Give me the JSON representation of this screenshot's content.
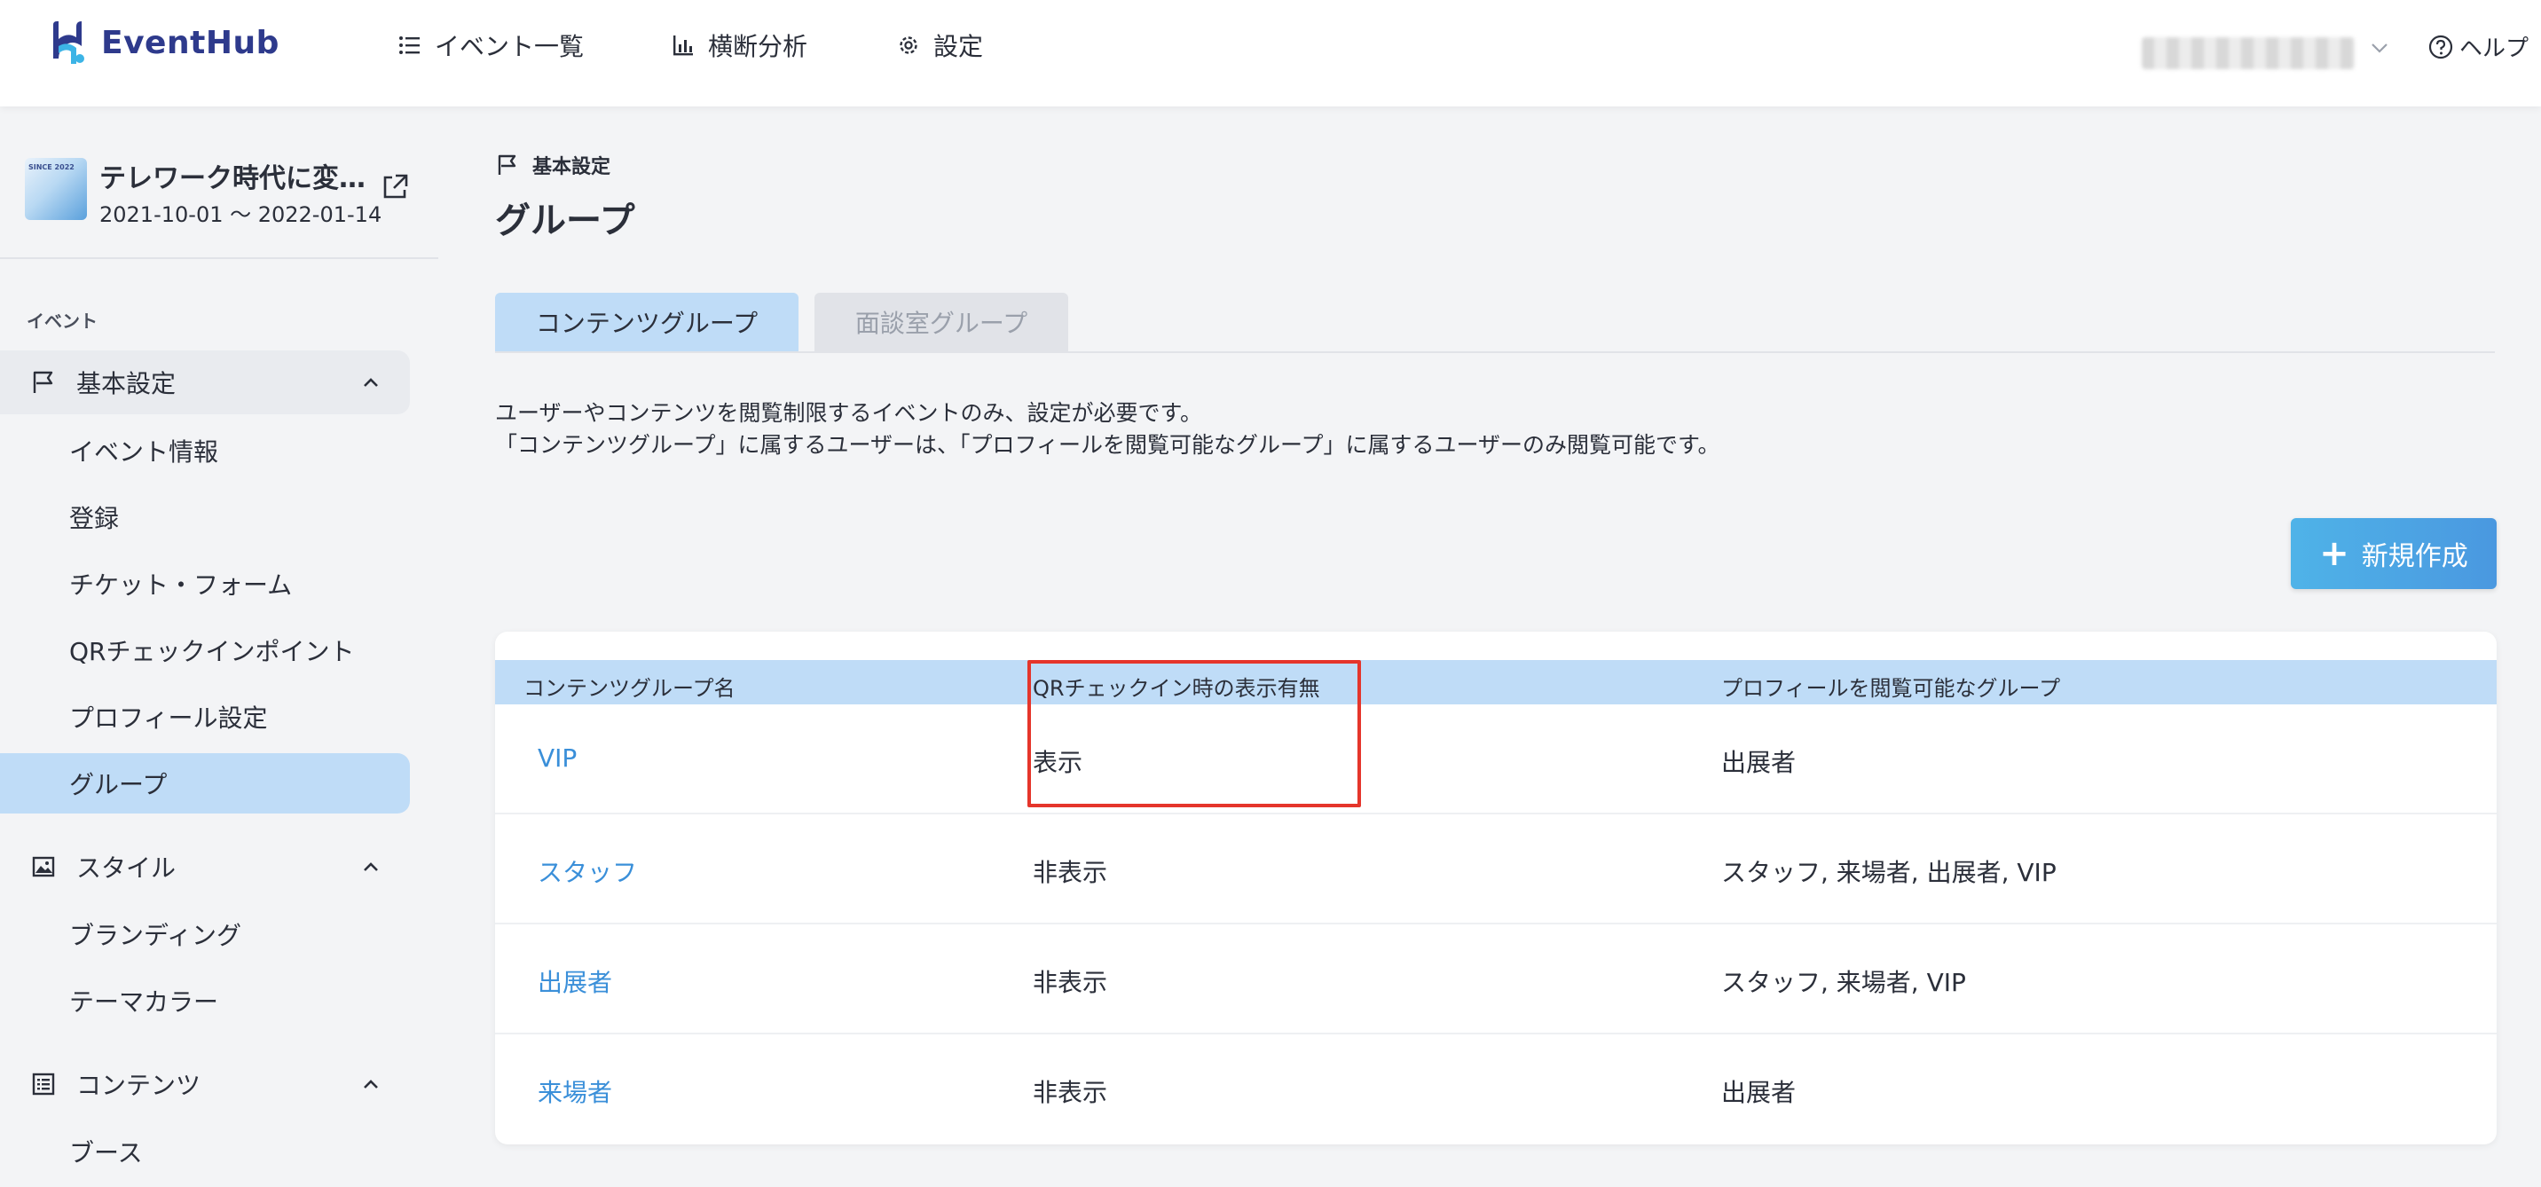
{
  "header": {
    "logo_text": "EventHub",
    "nav": [
      {
        "label": "イベント一覧",
        "icon": "list-icon"
      },
      {
        "label": "横断分析",
        "icon": "bar-chart-icon"
      },
      {
        "label": "設定",
        "icon": "gear-icon"
      }
    ],
    "help_label": "ヘルプ"
  },
  "sidebar": {
    "event": {
      "title": "テレワーク時代に変…",
      "dates": "2021-10-01 〜 2022-01-14",
      "thumb_text": "SINCE 2022"
    },
    "section_label": "イベント",
    "groups": [
      {
        "label": "基本設定",
        "icon": "flag-icon",
        "expanded": true,
        "items": [
          "イベント情報",
          "登録",
          "チケット・フォーム",
          "QRチェックインポイント",
          "プロフィール設定",
          "グループ"
        ]
      },
      {
        "label": "スタイル",
        "icon": "image-icon",
        "expanded": true,
        "items": [
          "ブランディング",
          "テーマカラー"
        ]
      },
      {
        "label": "コンテンツ",
        "icon": "document-list-icon",
        "expanded": true,
        "items": [
          "ブース"
        ]
      }
    ],
    "active_item": "グループ"
  },
  "main": {
    "breadcrumb": "基本設定",
    "title": "グループ",
    "tabs": [
      {
        "label": "コンテンツグループ",
        "active": true
      },
      {
        "label": "面談室グループ",
        "active": false
      }
    ],
    "description": [
      "ユーザーやコンテンツを閲覧制限するイベントのみ、設定が必要です。",
      "「コンテンツグループ」に属するユーザーは、「プロフィールを閲覧可能なグループ」に属するユーザーのみ閲覧可能です。"
    ],
    "new_button_label": "新規作成",
    "table": {
      "columns": [
        "コンテンツグループ名",
        "QRチェックイン時の表示有無",
        "プロフィールを閲覧可能なグループ"
      ],
      "rows": [
        {
          "name": "VIP",
          "qr_display": "表示",
          "viewable_groups": "出展者"
        },
        {
          "name": "スタッフ",
          "qr_display": "非表示",
          "viewable_groups": "スタッフ, 来場者, 出展者, VIP"
        },
        {
          "name": "出展者",
          "qr_display": "非表示",
          "viewable_groups": "スタッフ, 来場者, VIP"
        },
        {
          "name": "来場者",
          "qr_display": "非表示",
          "viewable_groups": "出展者"
        }
      ]
    }
  },
  "colors": {
    "accent": "#3a8fd9",
    "active_bg": "#bfdcf7",
    "highlight": "#e5352b",
    "button_start": "#4fb3e8",
    "button_end": "#4a98e0"
  }
}
